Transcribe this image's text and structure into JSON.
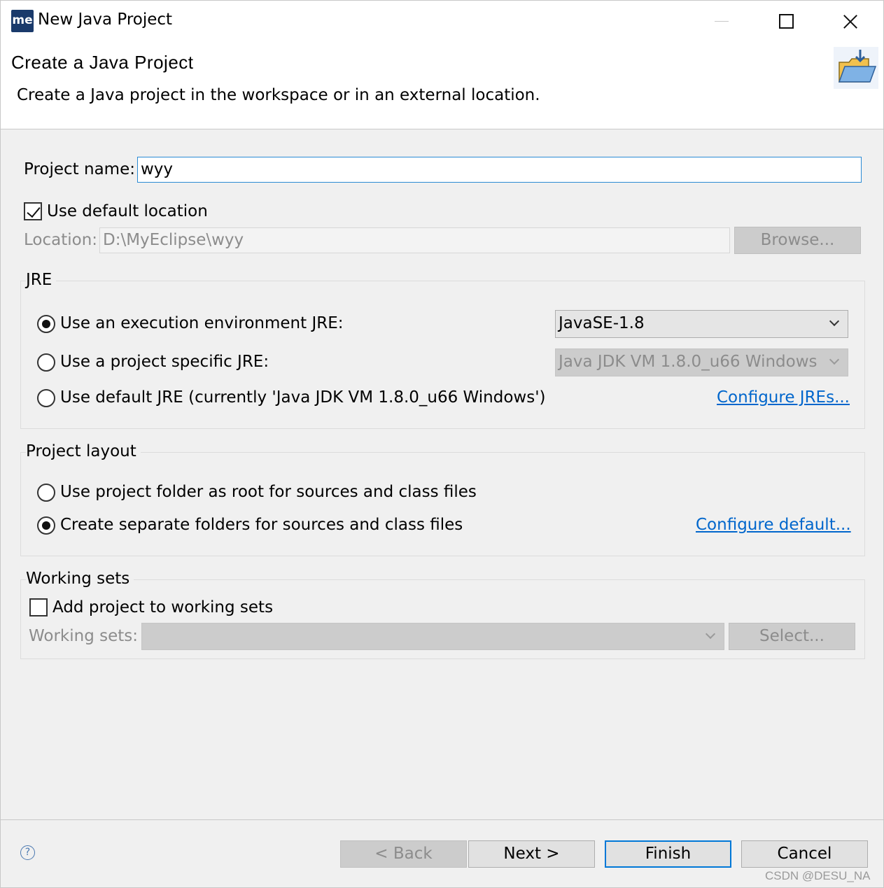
{
  "window": {
    "app_icon_text": "me",
    "title": "New Java Project"
  },
  "banner": {
    "title": "Create a Java Project",
    "description": "Create a Java project in the workspace or in an external location."
  },
  "project": {
    "name_label": "Project name:",
    "name_value": "wyy",
    "use_default_location_label": "Use default location",
    "use_default_location_checked": true,
    "location_label": "Location:",
    "location_value": "D:\\MyEclipse\\wyy",
    "browse_label": "Browse..."
  },
  "jre": {
    "group_title": "JRE",
    "options": [
      {
        "label": "Use an execution environment JRE:",
        "selected": true
      },
      {
        "label": "Use a project specific JRE:",
        "selected": false
      },
      {
        "label": "Use default JRE (currently 'Java JDK VM 1.8.0_u66 Windows')",
        "selected": false
      }
    ],
    "execution_env_value": "JavaSE-1.8",
    "project_specific_value": "Java JDK VM 1.8.0_u66 Windows",
    "configure_link": "Configure JREs..."
  },
  "layout": {
    "group_title": "Project layout",
    "options": [
      {
        "label": "Use project folder as root for sources and class files",
        "selected": false
      },
      {
        "label": "Create separate folders for sources and class files",
        "selected": true
      }
    ],
    "configure_link": "Configure default..."
  },
  "working_sets": {
    "group_title": "Working sets",
    "add_label": "Add project to working sets",
    "add_checked": false,
    "sets_label": "Working sets:",
    "sets_value": "",
    "select_label": "Select..."
  },
  "footer": {
    "help_glyph": "?",
    "back_label": "< Back",
    "next_label": "Next >",
    "finish_label": "Finish",
    "cancel_label": "Cancel"
  },
  "watermark": "CSDN @DESU_NA"
}
